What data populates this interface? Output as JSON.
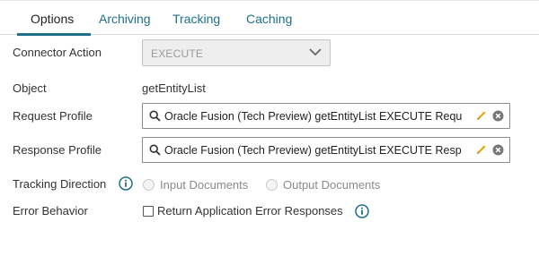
{
  "tabs": [
    {
      "label": "Options",
      "active": true
    },
    {
      "label": "Archiving",
      "active": false
    },
    {
      "label": "Tracking",
      "active": false
    },
    {
      "label": "Caching",
      "active": false
    }
  ],
  "fields": {
    "connector_action": {
      "label": "Connector Action",
      "value": "EXECUTE",
      "disabled": true
    },
    "object": {
      "label": "Object",
      "value": "getEntityList"
    },
    "request_profile": {
      "label": "Request Profile",
      "value": "Oracle Fusion (Tech Preview) getEntityList EXECUTE Requ"
    },
    "response_profile": {
      "label": "Response Profile",
      "value": "Oracle Fusion (Tech Preview) getEntityList EXECUTE Resp"
    },
    "tracking_direction": {
      "label": "Tracking Direction",
      "options": [
        {
          "label": "Input Documents",
          "selected": true
        },
        {
          "label": "Output Documents",
          "selected": false
        }
      ],
      "disabled": true
    },
    "error_behavior": {
      "label": "Error Behavior",
      "checkbox_label": "Return Application Error Responses",
      "checked": false
    }
  },
  "colors": {
    "accent": "#1f6f8b",
    "pencil": "#e0a800",
    "info": "#1f6f8b"
  },
  "icons": [
    "chevron-down-icon",
    "search-icon",
    "pencil-icon",
    "clear-icon",
    "info-icon"
  ]
}
